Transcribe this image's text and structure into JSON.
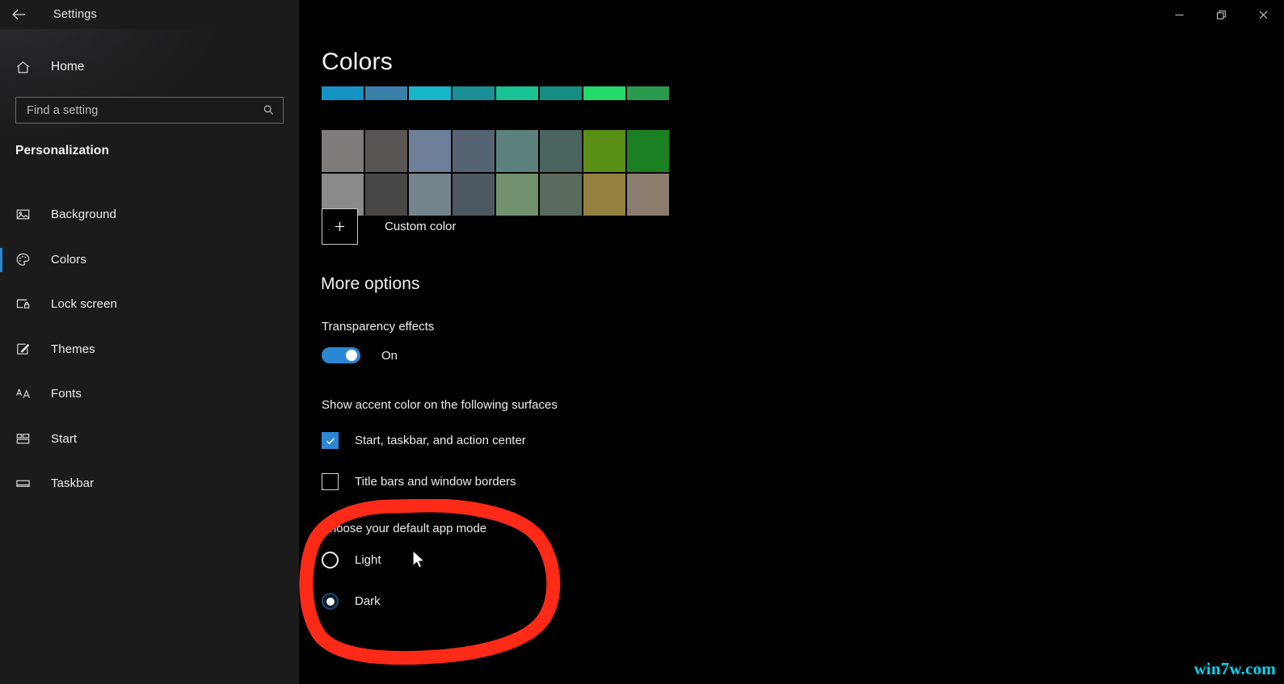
{
  "window": {
    "title": "Settings",
    "back_icon": "back-arrow-icon",
    "controls": {
      "minimize": "minimize-icon",
      "restore": "restore-icon",
      "close": "close-icon"
    }
  },
  "sidebar": {
    "home": {
      "label": "Home",
      "icon": "home-icon"
    },
    "search": {
      "placeholder": "Find a setting",
      "value": "",
      "icon": "search-icon"
    },
    "section_title": "Personalization",
    "items": [
      {
        "label": "Background",
        "icon": "image-icon",
        "selected": false
      },
      {
        "label": "Colors",
        "icon": "palette-icon",
        "selected": true
      },
      {
        "label": "Lock screen",
        "icon": "lock-screen-icon",
        "selected": false
      },
      {
        "label": "Themes",
        "icon": "brush-icon",
        "selected": false
      },
      {
        "label": "Fonts",
        "icon": "fonts-icon",
        "selected": false
      },
      {
        "label": "Start",
        "icon": "start-icon",
        "selected": false
      },
      {
        "label": "Taskbar",
        "icon": "taskbar-icon",
        "selected": false
      }
    ]
  },
  "main": {
    "page_title": "Colors",
    "swatches": {
      "row_top_clipped": [
        "#1592c4",
        "#3a7fa8",
        "#18b6c9",
        "#1b8f95",
        "#19c294",
        "#158d81",
        "#24da69",
        "#2a9a4e"
      ],
      "row_middle": [
        "#7e7b79",
        "#585553",
        "#6d7f99",
        "#566373",
        "#5d817c",
        "#4a6460",
        "#5a8f15",
        "#1b8022"
      ],
      "row_bottom": [
        "#8c8a88",
        "#494746",
        "#74838c",
        "#4d5860",
        "#72916f",
        "#5a6a5c",
        "#94813f",
        "#8a7d6d"
      ]
    },
    "custom_color": {
      "label": "Custom color",
      "icon": "plus-icon"
    },
    "more_options_title": "More options",
    "transparency": {
      "label": "Transparency effects",
      "state_label": "On",
      "checked": true
    },
    "accent_surfaces": {
      "label": "Show accent color on the following surfaces",
      "options": [
        {
          "label": "Start, taskbar, and action center",
          "checked": true
        },
        {
          "label": "Title bars and window borders",
          "checked": false
        }
      ]
    },
    "app_mode": {
      "label": "Choose your default app mode",
      "options": [
        {
          "label": "Light",
          "selected": false
        },
        {
          "label": "Dark",
          "selected": true
        }
      ]
    }
  },
  "annotation": {
    "shape": "red-ellipse-highlight",
    "color": "#fc2a16"
  },
  "cursor": {
    "icon": "mouse-pointer-icon"
  },
  "watermark": {
    "text": "win7w.com",
    "color": "#00d9f5"
  },
  "colors": {
    "accent": "#2b86d4",
    "sidebar_bg": "#1b1b1b",
    "content_bg": "#000000",
    "text": "#ededed"
  }
}
